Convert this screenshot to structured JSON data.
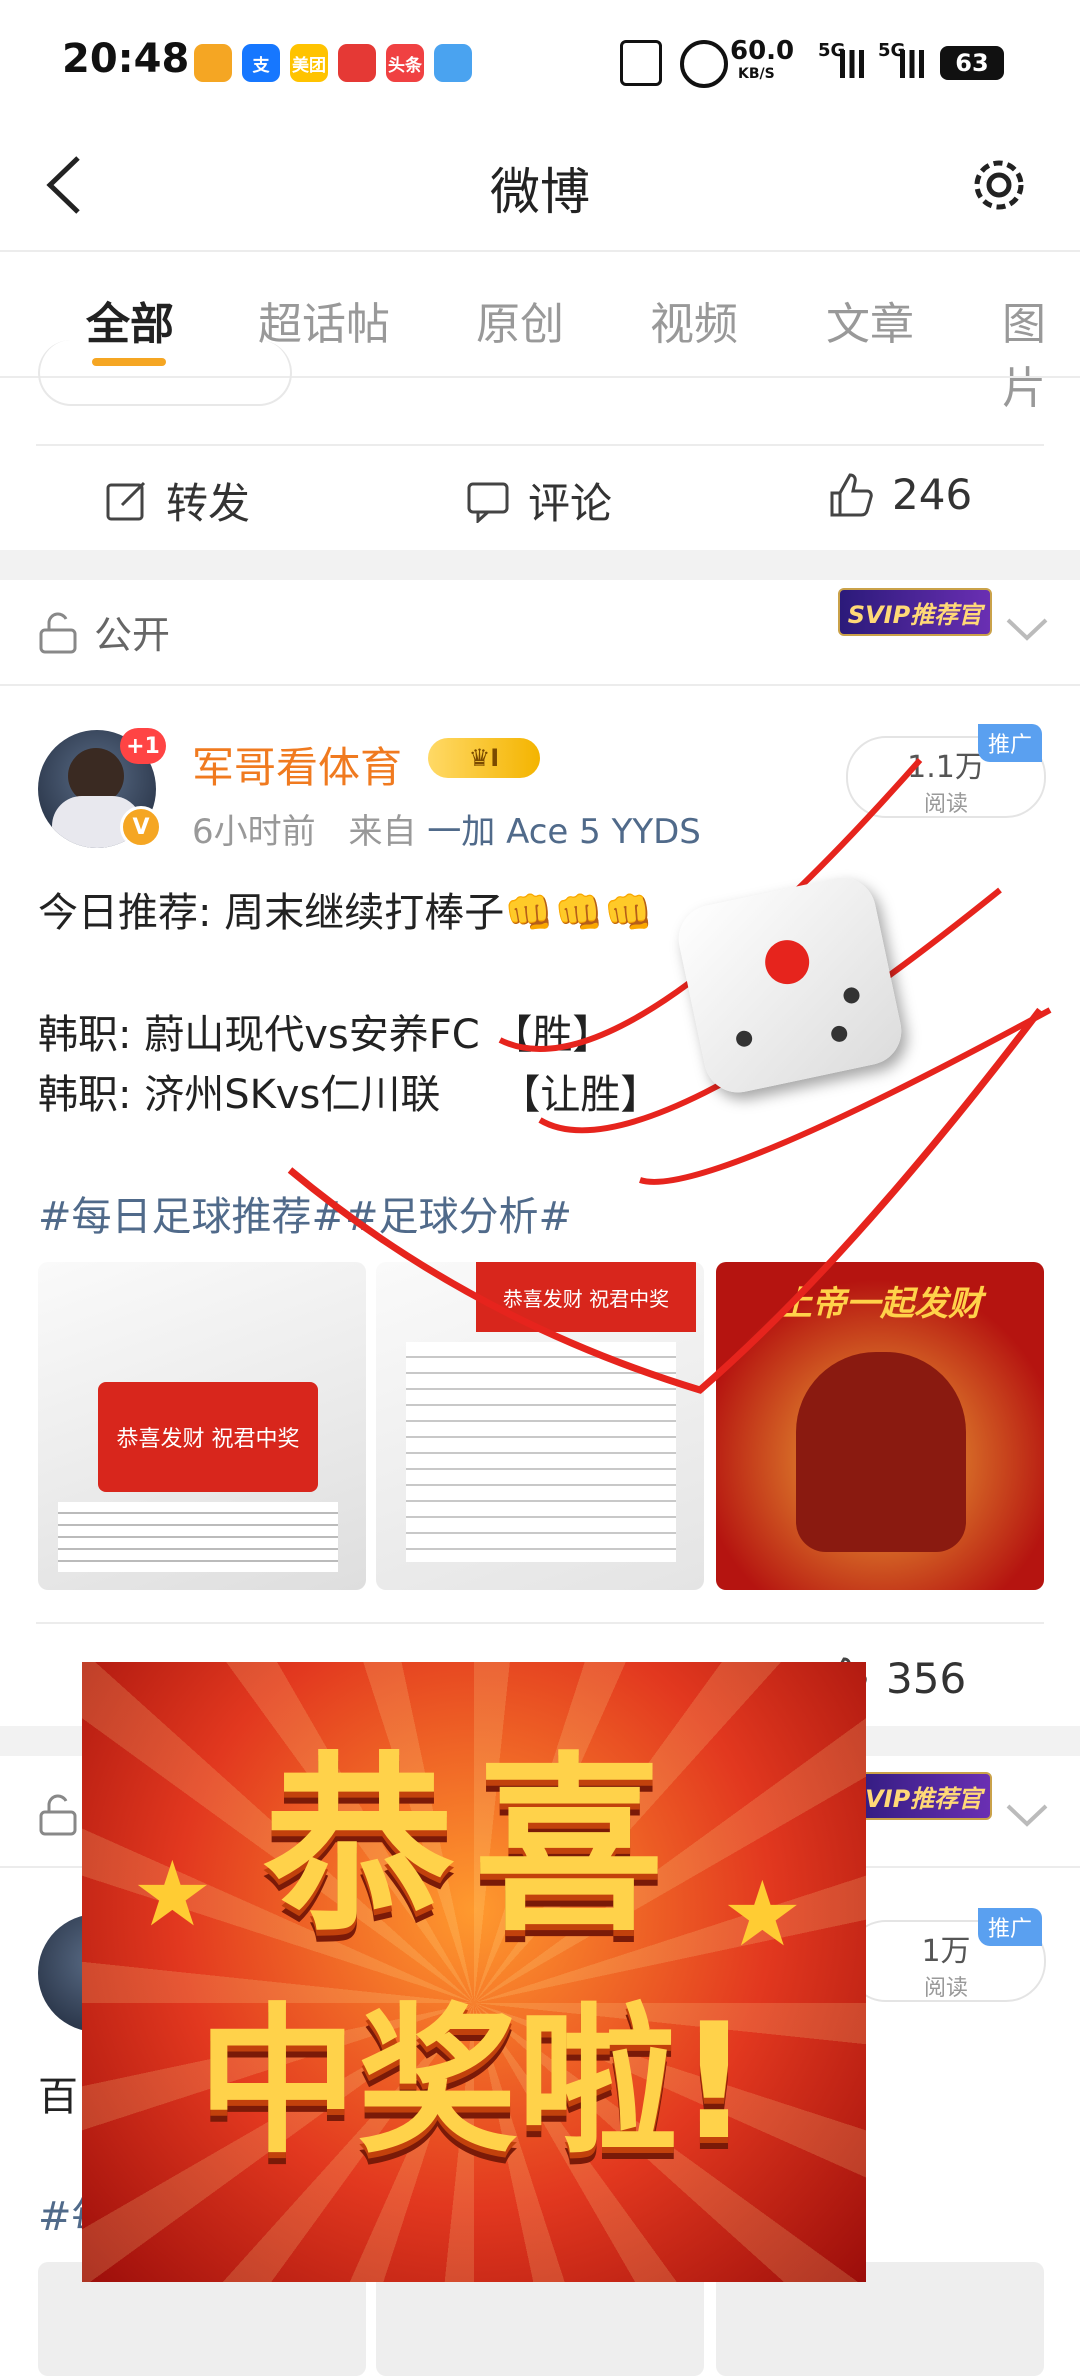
{
  "status_bar": {
    "time": "20:48",
    "apps": [
      {
        "name": "weibo-app-icon",
        "label": "",
        "color": "#f5a623"
      },
      {
        "name": "alipay-app-icon",
        "label": "支",
        "color": "#1677ff"
      },
      {
        "name": "meituan-app-icon",
        "label": "美团",
        "color": "#ffc300"
      },
      {
        "name": "app-icon-4",
        "label": "",
        "color": "#e53935"
      },
      {
        "name": "toutiao-app-icon",
        "label": "头条",
        "color": "#f04142"
      },
      {
        "name": "weather-app-icon",
        "label": "",
        "color": "#4aa3f0"
      }
    ],
    "net_speed": "60.0",
    "net_unit": "KB/S",
    "signal_1": "5G",
    "signal_2": "5G",
    "battery": "63"
  },
  "nav": {
    "title": "微博"
  },
  "tabs": [
    "全部",
    "超话帖",
    "原创",
    "视频",
    "文章",
    "图片"
  ],
  "top_actions": {
    "repost": "转发",
    "comment": "评论",
    "like_count": "246"
  },
  "visibility": {
    "label": "公开",
    "svip": "SVIP推荐官"
  },
  "post": {
    "badge": "+1",
    "username": "军哥看体育",
    "crown_label": "I",
    "time": "6小时前",
    "from": "来自",
    "source": "一加 Ace 5 YYDS",
    "reads": "1.1万",
    "reads_label": "阅读",
    "promo": "推广",
    "line1": "今日推荐: 周末继续打棒子👊👊👊",
    "line2": "韩职: 蔚山现代vs安养FC 【胜】",
    "line3": "韩职: 济州SKvs仁川联　　【让胜】",
    "hashtags": "#每日足球推荐##足球分析#",
    "thumb_texts": [
      "恭喜发财 祝君中奖",
      "恭喜发财 祝君中奖",
      "上帝一起发财"
    ],
    "like_count": "356"
  },
  "second_post": {
    "reads": "1万",
    "reads_label": "阅读",
    "promo": "推广",
    "svip": "SVIP推荐官",
    "partial_text": "百",
    "partial_hashtag": "#每"
  },
  "overlay": {
    "line1": "恭喜",
    "line2": "中奖啦!"
  }
}
